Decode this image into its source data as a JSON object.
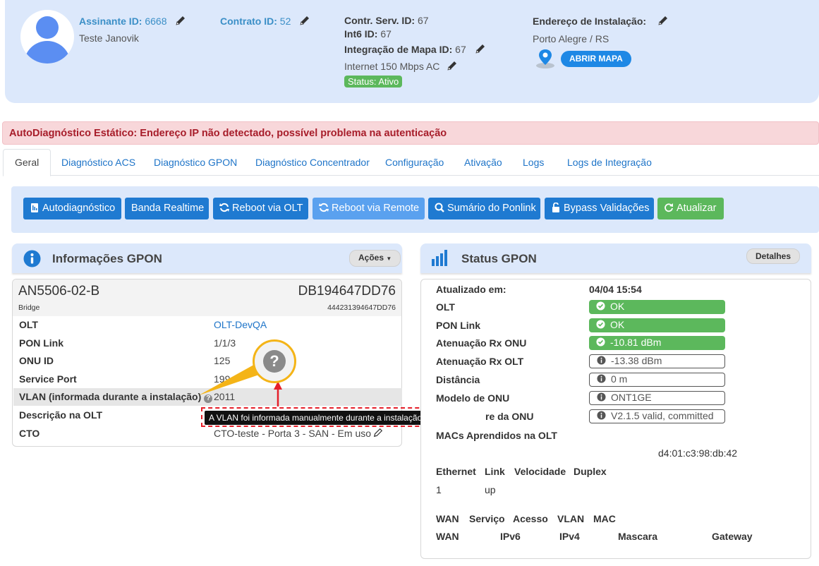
{
  "header": {
    "assinante_label": "Assinante ID:",
    "assinante_value": "6668",
    "cliente_nome": "Teste Janovik",
    "contrato_label": "Contrato ID:",
    "contrato_value": "52",
    "contr_serv_label": "Contr. Serv. ID:",
    "contr_serv_value": "67",
    "int6_label": "Int6 ID:",
    "int6_value": "67",
    "integracao_label": "Integração de Mapa ID:",
    "integracao_value": "67",
    "plano": "Internet 150 Mbps AC",
    "status": "Status: Ativo",
    "endereco_label": "Endereço de Instalação:",
    "cidade": "Porto Alegre / RS",
    "abrir_mapa": "ABRIR MAPA"
  },
  "alert": {
    "text": "AutoDiagnóstico Estático: Endereço IP não detectado, possível problema na autenticação"
  },
  "tabs": [
    {
      "label": "Geral"
    },
    {
      "label": "Diagnóstico ACS"
    },
    {
      "label": "Diagnóstico GPON"
    },
    {
      "label": "Diagnóstico Concentrador"
    },
    {
      "label": "Configuração"
    },
    {
      "label": "Ativação"
    },
    {
      "label": "Logs"
    },
    {
      "label": "Logs de Integração"
    }
  ],
  "toolbar": {
    "autodiagnostico": "Autodiagnóstico",
    "banda_realtime": "Banda Realtime",
    "reboot_olt": "Reboot via OLT",
    "reboot_remote": "Reboot via Remote",
    "sumario_ponlink": "Sumário do Ponlink",
    "bypass": "Bypass Validações",
    "atualizar": "Atualizar"
  },
  "info_gpon": {
    "title": "Informações GPON",
    "acoes": "Ações",
    "modelo": "AN5506-02-B",
    "modo": "Bridge",
    "serial": "DB194647DD76",
    "serial_sub": "444231394647DD76",
    "rows": [
      {
        "k": "OLT",
        "v": "OLT-DevQA"
      },
      {
        "k": "PON Link",
        "v": "1/1/3"
      },
      {
        "k": "ONU ID",
        "v": "125"
      },
      {
        "k": "Service Port",
        "v": "199"
      },
      {
        "k": "VLAN (informada durante a instalação)",
        "v": "2011"
      },
      {
        "k": "Descrição na OLT",
        "v": ""
      },
      {
        "k": "CTO",
        "v": "CTO-teste - Porta 3 - SAN - Em uso"
      }
    ],
    "tooltip": "A VLAN foi informada manualmente durante a instalação do cliente"
  },
  "status_gpon": {
    "title": "Status GPON",
    "detalhes": "Detalhes",
    "atualizado_label": "Atualizado em:",
    "atualizado_value": "04/04 15:54",
    "rows": [
      {
        "k": "OLT",
        "v": "OK"
      },
      {
        "k": "PON Link",
        "v": "OK"
      },
      {
        "k": "Atenuação Rx ONU",
        "v": "-10.81 dBm"
      },
      {
        "k": "Atenuação Rx OLT",
        "v": "-13.38 dBm"
      },
      {
        "k": "Distância",
        "v": "0 m"
      },
      {
        "k": "Modelo de ONU",
        "v": "ONT1GE"
      },
      {
        "k": "re da ONU",
        "v": "V2.1.5 valid, committed"
      }
    ],
    "macs_label": "MACs Aprendidos na OLT",
    "mac": "d4:01:c3:98:db:42",
    "eth_headers": [
      "Ethernet",
      "Link",
      "Velocidade",
      "Duplex"
    ],
    "eth_row": [
      "1",
      "up"
    ],
    "wan_headers": [
      "WAN",
      "Serviço",
      "Acesso",
      "VLAN",
      "MAC"
    ],
    "wan_headers2": [
      "WAN",
      "IPv6",
      "IPv4",
      "Mascara",
      "Gateway"
    ]
  },
  "colors": {
    "primary": "#1f7ad1",
    "success": "#5cb85c",
    "danger_text": "#a71d2a",
    "header_bg": "#dce8fb"
  }
}
